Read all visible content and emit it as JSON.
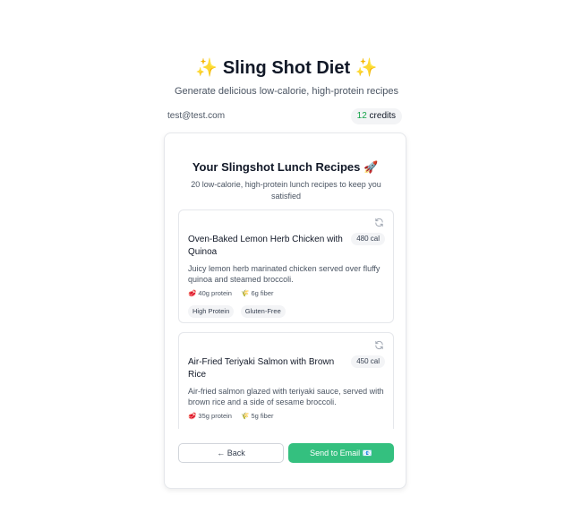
{
  "header": {
    "title": "✨ Sling Shot Diet ✨",
    "subtitle": "Generate delicious low-calorie, high-protein recipes"
  },
  "account": {
    "email": "test@test.com",
    "credits_count": "12",
    "credits_label": "credits"
  },
  "card": {
    "title": "Your Slingshot Lunch Recipes 🚀",
    "subtitle": "20 low-calorie, high-protein lunch recipes to keep you satisfied"
  },
  "recipes": [
    {
      "name": "Oven-Baked Lemon Herb Chicken with Quinoa",
      "calories": "480 cal",
      "description": "Juicy lemon herb marinated chicken served over fluffy quinoa and steamed broccoli.",
      "protein": "🥩 40g protein",
      "fiber": "🌾 6g fiber",
      "tags": [
        "High Protein",
        "Gluten-Free"
      ]
    },
    {
      "name": "Air-Fried Teriyaki Salmon with Brown Rice",
      "calories": "450 cal",
      "description": "Air-fried salmon glazed with teriyaki sauce, served with brown rice and a side of sesame broccoli.",
      "protein": "🥩 35g protein",
      "fiber": "🌾 5g fiber"
    }
  ],
  "actions": {
    "back_label": "← Back",
    "send_label": "Send to Email 📧"
  },
  "colors": {
    "accent": "#34c07f",
    "credits_number": "#16a34a"
  },
  "icons": {
    "refresh": "refresh-icon"
  }
}
